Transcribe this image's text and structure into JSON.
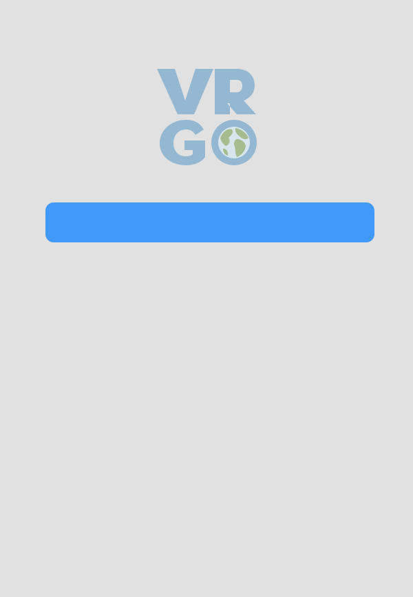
{
  "app": {
    "logo_text": "VRGO"
  },
  "main": {
    "primary_button": {
      "label": "",
      "color": "#4199fa"
    }
  },
  "colors": {
    "background": "#e1e1e1",
    "logo_letters": "#94b7d2",
    "globe_land": "#a6bc8e",
    "globe_water": "#d6e6ec",
    "button": "#4199fa"
  },
  "icons": {
    "logo": "vrgo-logo",
    "globe": "globe-icon"
  }
}
